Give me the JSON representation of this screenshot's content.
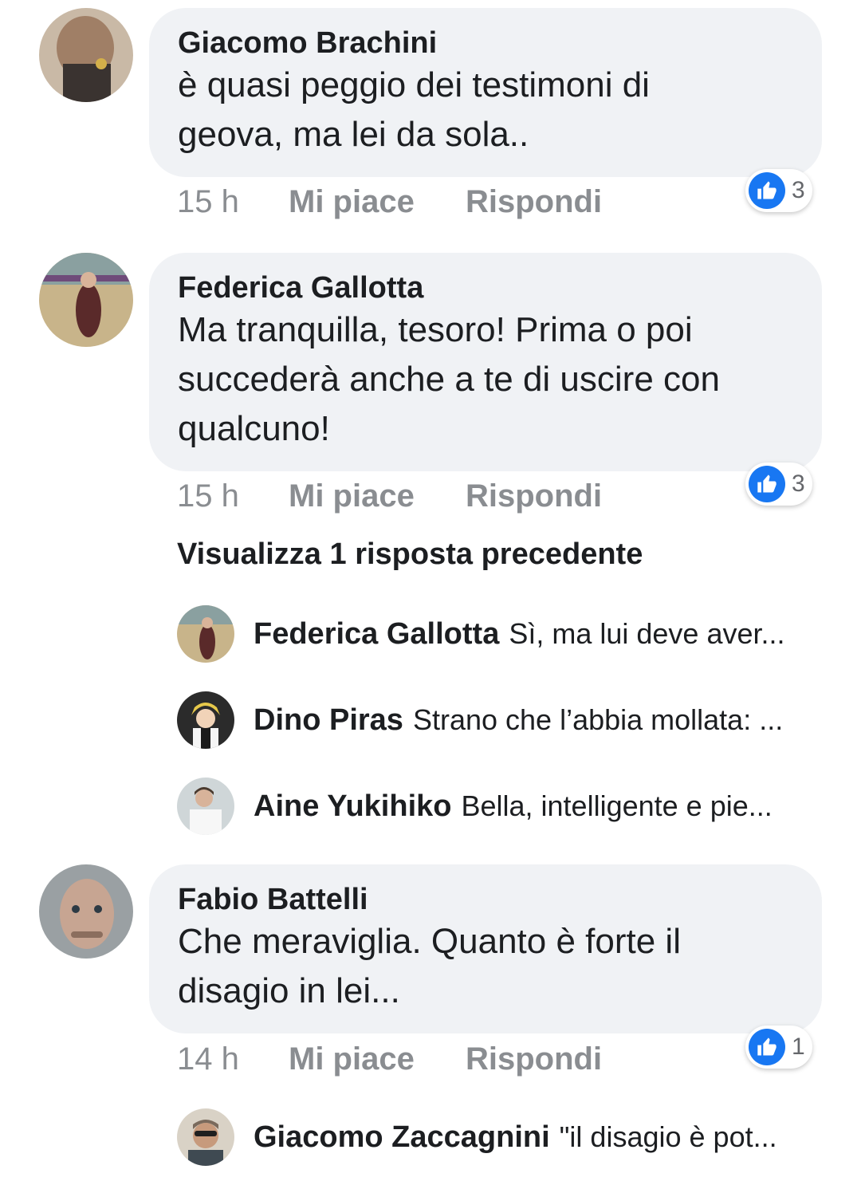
{
  "comments": [
    {
      "author": "Giacomo Brachini",
      "text_line1": "è quasi peggio dei testimoni di",
      "text_line2": "geova, ma lei da sola..",
      "time": "15 h",
      "like": "Mi piace",
      "reply": "Rispondi",
      "reactions": "3"
    },
    {
      "author": "Federica Gallotta",
      "text_line1": "Ma tranquilla, tesoro! Prima o poi",
      "text_line2": "succederà anche a te di uscire con",
      "text_line3": "qualcuno!",
      "time": "15 h",
      "like": "Mi piace",
      "reply": "Rispondi",
      "reactions": "3",
      "view_previous": "Visualizza 1 risposta precedente",
      "replies": [
        {
          "name": "Federica Gallotta",
          "snippet": "Sì, ma lui deve aver..."
        },
        {
          "name": "Dino Piras",
          "snippet": "Strano che l’abbia mollata: ..."
        },
        {
          "name": "Aine Yukihiko",
          "snippet": "Bella, intelligente e pie..."
        }
      ]
    },
    {
      "author": "Fabio Battelli",
      "text_line1": "Che meraviglia. Quanto è  forte il",
      "text_line2": "disagio in lei...",
      "time": "14 h",
      "like": "Mi piace",
      "reply": "Rispondi",
      "reactions": "1",
      "replies": [
        {
          "name": "Giacomo Zaccagnini",
          "snippet": "\"il disagio è pot..."
        }
      ]
    }
  ],
  "colors": {
    "bubble": "#f0f2f5",
    "meta_text": "#8a8d91",
    "like_blue": "#1877f2",
    "text": "#1c1e21"
  },
  "icons": {
    "reaction": "thumbs-up-icon"
  }
}
